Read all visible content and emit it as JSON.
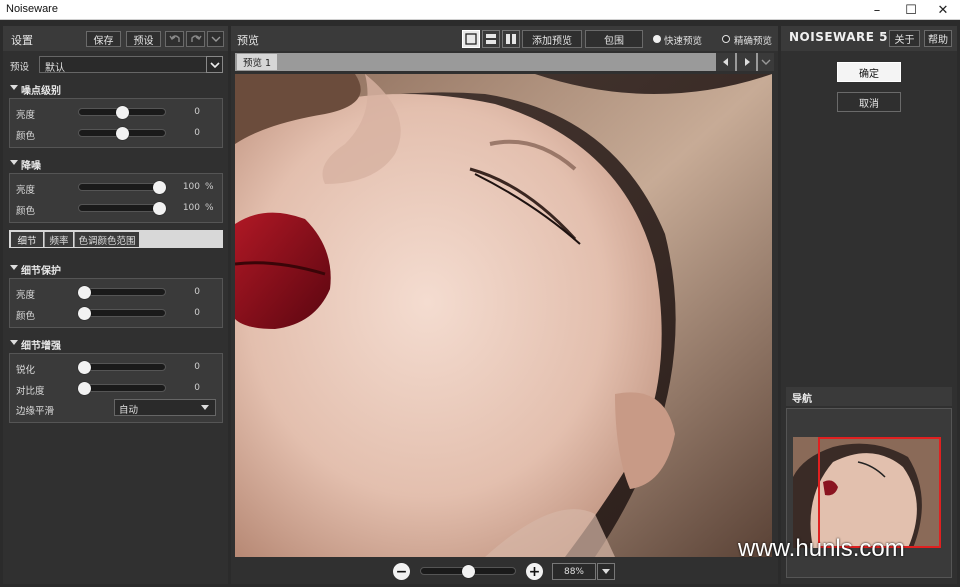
{
  "window": {
    "title": "Noiseware",
    "controls": {
      "minimize": "–",
      "maximize": "☐",
      "close": "✕"
    }
  },
  "settings_panel": {
    "title": "设置",
    "save_label": "保存",
    "preset_button_label": "预设",
    "preset_label": "预设",
    "preset_value": "默认",
    "noise_level": {
      "title": "噪点级别",
      "rows": [
        {
          "label": "亮度",
          "value": "0",
          "level": 0.5
        },
        {
          "label": "颜色",
          "value": "0",
          "level": 0.5
        }
      ]
    },
    "noise_reduction": {
      "title": "降噪",
      "rows": [
        {
          "label": "亮度",
          "value": "100",
          "unit": "%",
          "level": 1.0
        },
        {
          "label": "颜色",
          "value": "100",
          "unit": "%",
          "level": 1.0
        }
      ]
    },
    "tabs": [
      "细节",
      "频率",
      "色调颜色范围"
    ],
    "detail_protection": {
      "title": "细节保护",
      "rows": [
        {
          "label": "亮度",
          "value": "0",
          "level": 0.0
        },
        {
          "label": "颜色",
          "value": "0",
          "level": 0.0
        }
      ]
    },
    "detail_enhancement": {
      "title": "细节增强",
      "rows": [
        {
          "label": "锐化",
          "value": "0",
          "level": 0.0
        },
        {
          "label": "对比度",
          "value": "0",
          "level": 0.0
        }
      ],
      "edge_smooth_label": "边缘平滑",
      "edge_smooth_value": "自动"
    }
  },
  "preview_panel": {
    "title": "预览",
    "add_preview_label": "添加预览",
    "crop_label": "包围",
    "fast_preview_label": "快速预览",
    "precise_preview_label": "精确预览",
    "tab_label": "预览 1",
    "zoom_value": "88%",
    "zoom_level": 0.5,
    "minus": "−",
    "plus": "+"
  },
  "right_panel": {
    "brand": "NOISEWARE 5",
    "about_label": "关于",
    "help_label": "帮助",
    "ok_label": "确定",
    "cancel_label": "取消",
    "navigator_title": "导航"
  },
  "watermark": "www.hunls.com",
  "colors": {
    "panel_bg": "#303030",
    "section_bg": "#3a3a3a",
    "nav_frame": "#e02020",
    "active_tab": "#f2f2f2"
  }
}
